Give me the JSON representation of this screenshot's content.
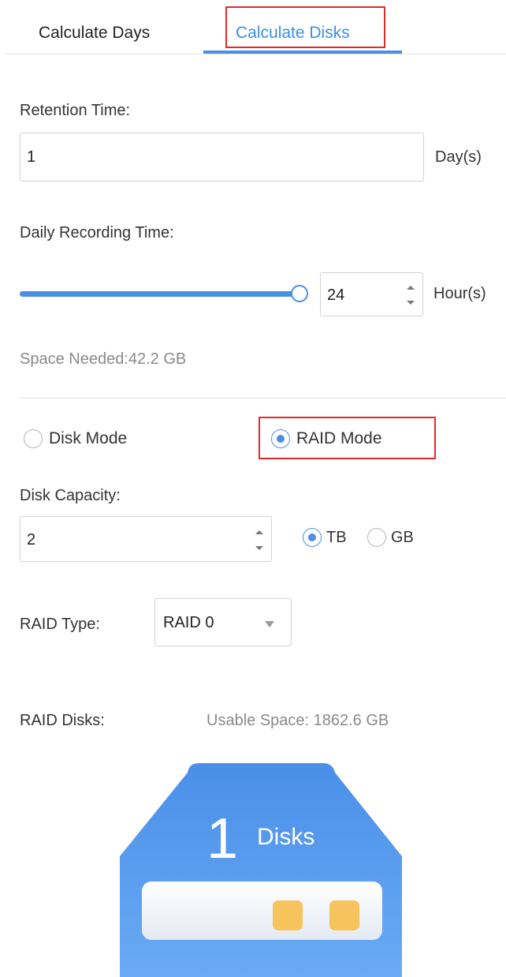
{
  "tabs": [
    {
      "label": "Calculate Days",
      "active": false
    },
    {
      "label": "Calculate Disks",
      "active": true
    }
  ],
  "retention": {
    "label": "Retention Time:",
    "value": "1",
    "unit": "Day(s)"
  },
  "recording": {
    "label": "Daily Recording Time:",
    "slider_fraction": 1.0,
    "value": "24",
    "unit": "Hour(s)"
  },
  "space_needed": "Space Needed:42.2 GB",
  "mode": {
    "disk_mode_label": "Disk Mode",
    "raid_mode_label": "RAID Mode",
    "selected": "raid"
  },
  "capacity": {
    "label": "Disk Capacity:",
    "value": "2",
    "unit_tb": "TB",
    "unit_gb": "GB",
    "selected_unit": "TB"
  },
  "raid_type": {
    "label": "RAID Type:",
    "value": "RAID 0"
  },
  "raid_disks": {
    "label": "RAID Disks:",
    "usable_space": "Usable Space: 1862.6 GB",
    "count": "1",
    "unit": "Disks"
  },
  "colors": {
    "accent": "#4a90e2",
    "highlight": "#e02a2a",
    "disk_light": "#6aaaf5",
    "disk_dark": "#4a8fe8",
    "indicator": "#f7c35c"
  }
}
